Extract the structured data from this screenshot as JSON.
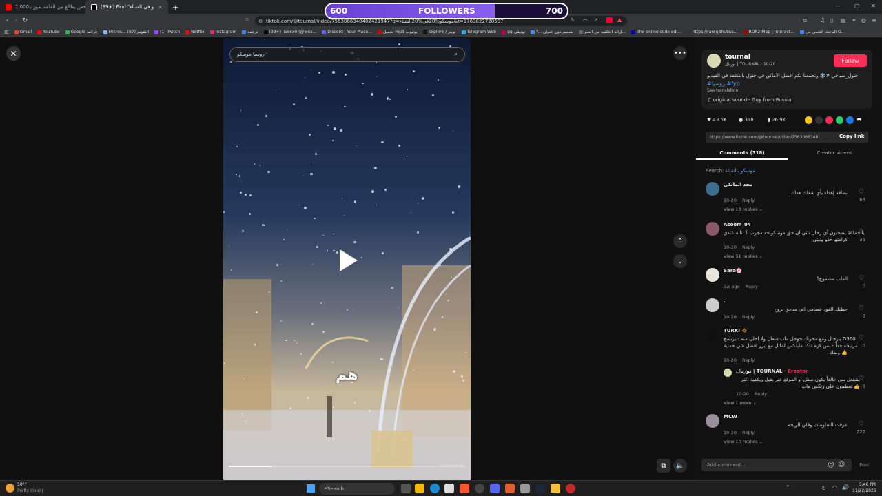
{
  "browser": {
    "tabs": [
      {
        "label": "اكثر شخص يطالع من القاعه يفوز بـ1,000$ ...",
        "active": false
      },
      {
        "label": "(99+) Find \"موسكو في الشتاء\" on ...",
        "active": true
      }
    ],
    "new_tab": "+",
    "url": "tiktok.com/@tournal/video/7563066348402421947?q=موسكو%20في%20الشتاء&t=1763822720597",
    "bookmarks": [
      "Gmail",
      "YouTube",
      "Google خرائط",
      "Micros... التقويم (87)",
      "(1) Twitch",
      "Netflix",
      "Instagram",
      "ترجمة",
      "(99+) livexx0 (@wex...",
      "Discord | Your Place...",
      "تحميل mp3 يوتيوب",
      "Explore / تويتر",
      "Telegram Web",
      "gg توتيقي",
      "Y... تصميم دون عنوان",
      "إزالة الخلفية من الصو...",
      "The online code edi...",
      "https://raw.githubus...",
      "RDR2 Map | Interact...",
      "الباحث العلمي من G..."
    ]
  },
  "overlay": {
    "left": "600",
    "label": "FOLLOWERS",
    "right": "700",
    "progress": 0.7
  },
  "video": {
    "search_text": "روسيا موسكو",
    "caption": "هم",
    "time": "00:00/00:45",
    "progress": 0.18
  },
  "panel": {
    "author": "tournal",
    "handle": "تورنال | TOURNAL · 10-20",
    "follow": "Follow",
    "desc": "موسكو #جتول_سياحي #❄️ وتجمعنا لكم أفضل الأماكن في جتول بالتكلفة في الفيديو",
    "tags": "#روسيا #fyp",
    "see_translation": "See translation",
    "sound": "original sound - Guy from Russia",
    "likes": "43.5K",
    "comments": "318",
    "saves": "26.9K",
    "link": "https://www.tiktok.com/@tournal/video/7563066348...",
    "copy": "Copy link",
    "tab_comments": "Comments (318)",
    "tab_creator": "Creator videos",
    "search_label": "Search:",
    "search_term": "موسكو بالشتاء"
  },
  "comments": [
    {
      "name": "مجد المالكي",
      "text": "بطاقة إهداء بأي شغلك هذاك",
      "date": "10-20",
      "reply": "Reply",
      "likes": "64",
      "more": "View 18 replies",
      "color": "#3b6e8f"
    },
    {
      "name": "Asoom_94",
      "text": "يا جماعة يصحبون أي رحال شي ان حق موسكو حد مجرب ؟ انا ماعندي",
      "text2": "كرامتها حلو ونيتي",
      "date": "10-20",
      "reply": "Reply",
      "likes": "36",
      "more": "View 51 replies",
      "color": "#8a5a6a"
    },
    {
      "name": "Sara🌸",
      "text": "القلب مسموح؟",
      "date": "1w ago",
      "reply": "Reply",
      "likes": "0",
      "color": "#e8e4d8"
    },
    {
      "name": ".",
      "text": "حظتك الفود عصامي اني مدحق بروح",
      "date": "10-26",
      "reply": "Reply",
      "likes": "0",
      "color": "#ccc"
    },
    {
      "name": "TURKI 🔅",
      "text": "يارجال ومع مجرتك جوجل ماب شغال ولا احلى منه - برنامج D360",
      "text2": "مرتيحه جداً - بس لازم تاكد مايلكس لماتل مع ايزر افضل شي حماية",
      "text3": "ولماذ 👍",
      "date": "10-20",
      "reply": "Reply",
      "likes": "0",
      "color": "#111"
    },
    {
      "name": "تورنال | TOURNAL",
      "creator": "· Creator",
      "text": "يشتغل بس عالقاً يكون مطل أو الموقع عبر بقيل ريكفية اكثر",
      "text2": "تعطمون على زنكس ماب 👍",
      "date": "10-20",
      "reply": "Reply",
      "likes": "0",
      "more": "View 1 more",
      "color": "#d9d9b0"
    },
    {
      "name": "MCW",
      "text": "عرفت السلومات وقلي الريحه",
      "date": "10-20",
      "reply": "Reply",
      "likes": "722",
      "more": "View 10 replies",
      "color": "#9a8f9e"
    }
  ],
  "add_comment": "Add comment...",
  "post": "Post",
  "taskbar": {
    "weather_temp": "50°F",
    "weather_text": "Partly cloudy",
    "search": "Search",
    "time": "5:46 PM",
    "date": "11/22/2025",
    "lang": "ع"
  }
}
